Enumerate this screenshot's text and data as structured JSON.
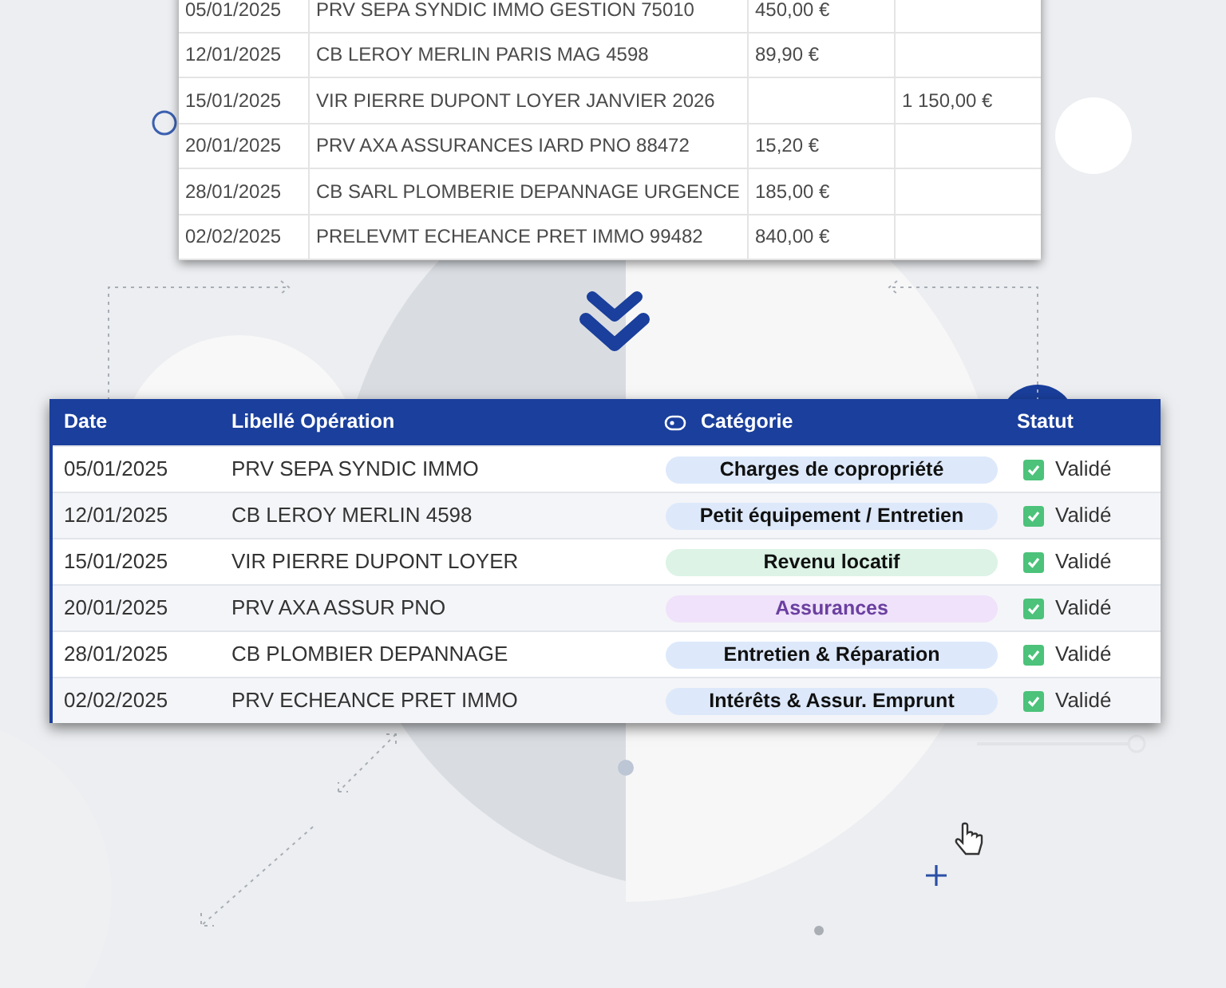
{
  "bank_table": {
    "rows": [
      {
        "date": "05/01/2025",
        "label": "PRV SEPA SYNDIC IMMO GESTION 75010",
        "debit": "450,00 €",
        "credit": ""
      },
      {
        "date": "12/01/2025",
        "label": "CB LEROY MERLIN PARIS MAG 4598",
        "debit": "89,90 €",
        "credit": ""
      },
      {
        "date": "15/01/2025",
        "label": "VIR PIERRE DUPONT LOYER JANVIER 2026",
        "debit": "",
        "credit": "1 150,00 €"
      },
      {
        "date": "20/01/2025",
        "label": "PRV AXA ASSURANCES IARD PNO 88472",
        "debit": "15,20 €",
        "credit": ""
      },
      {
        "date": "28/01/2025",
        "label": "CB SARL PLOMBERIE DEPANNAGE URGENCE",
        "debit": "185,00 €",
        "credit": ""
      },
      {
        "date": "02/02/2025",
        "label": "PRELEVMT ECHEANCE PRET IMMO 99482",
        "debit": "840,00 €",
        "credit": ""
      }
    ]
  },
  "categorized_table": {
    "columns": [
      "Date",
      "Libellé Opération",
      "Catégorie",
      "Statut"
    ],
    "rows": [
      {
        "date": "05/01/2025",
        "label": "PRV SEPA SYNDIC IMMO",
        "category": "Charges de copropriété",
        "color": "#dde9fb",
        "kind": "plain",
        "checked": true,
        "status": "Validé"
      },
      {
        "date": "12/01/2025",
        "label": "CB LEROY MERLIN 4598",
        "category": "Petit équipement / Entretien",
        "color": "#dde9fb",
        "kind": "plain",
        "checked": true,
        "status": "Validé"
      },
      {
        "date": "15/01/2025",
        "label": "VIR PIERRE DUPONT LOYER",
        "category": "Revenu locatif",
        "color": "#dcf3e6",
        "kind": "plain",
        "checked": true,
        "status": "Validé"
      },
      {
        "date": "20/01/2025",
        "label": "PRV AXA ASSUR PNO",
        "category": "Assurances",
        "color": "#efe2fa",
        "kind": "accent",
        "checked": true,
        "status": "Validé"
      },
      {
        "date": "28/01/2025",
        "label": "CB PLOMBIER DEPANNAGE",
        "category": "Entretien & Réparation",
        "color": "#dde9fb",
        "kind": "plain",
        "checked": true,
        "status": "Validé"
      },
      {
        "date": "02/02/2025",
        "label": "PRV ECHEANCE PRET IMMO",
        "category": "Intérêts & Assur. Emprunt",
        "color": "#dde9fb",
        "kind": "plain",
        "checked": true,
        "status": "Validé"
      }
    ]
  }
}
